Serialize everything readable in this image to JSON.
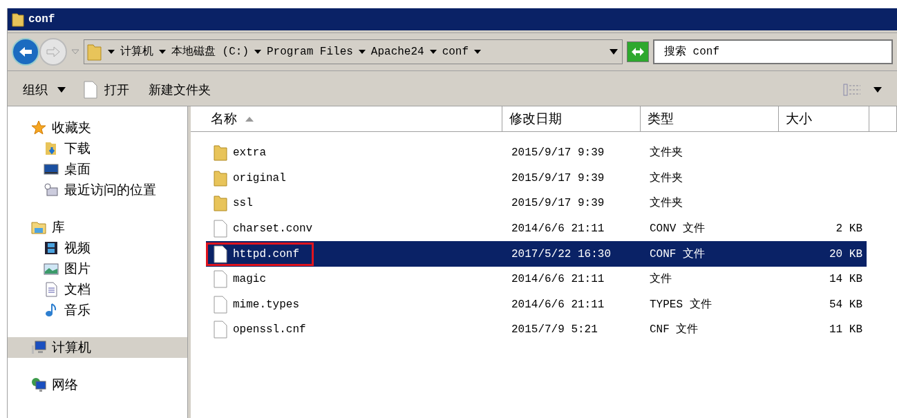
{
  "window": {
    "title": "conf"
  },
  "breadcrumbs": [
    "计算机",
    "本地磁盘 (C:)",
    "Program Files",
    "Apache24",
    "conf"
  ],
  "search": {
    "value": "搜索 conf"
  },
  "toolbar": {
    "organize": "组织",
    "open": "打开",
    "new_folder": "新建文件夹"
  },
  "sidebar": {
    "groups": [
      {
        "label": "收藏夹",
        "kind": "star",
        "selected": false,
        "children": [
          {
            "label": "下载",
            "kind": "download"
          },
          {
            "label": "桌面",
            "kind": "desktop"
          },
          {
            "label": "最近访问的位置",
            "kind": "recent"
          }
        ]
      },
      {
        "label": "库",
        "kind": "library",
        "selected": false,
        "children": [
          {
            "label": "视频",
            "kind": "video"
          },
          {
            "label": "图片",
            "kind": "image"
          },
          {
            "label": "文档",
            "kind": "doc"
          },
          {
            "label": "音乐",
            "kind": "music"
          }
        ]
      },
      {
        "label": "计算机",
        "kind": "computer",
        "selected": true
      },
      {
        "label": "网络",
        "kind": "network",
        "selected": false
      }
    ]
  },
  "table": {
    "columns": [
      {
        "label": "名称",
        "sorted": true
      },
      {
        "label": "修改日期",
        "sorted": false
      },
      {
        "label": "类型",
        "sorted": false
      },
      {
        "label": "大小",
        "sorted": false
      }
    ],
    "rows": [
      {
        "kind": "folder",
        "name": "extra",
        "date": "2015/9/17 9:39",
        "type": "文件夹",
        "selected": false,
        "highlighted": false
      },
      {
        "kind": "folder",
        "name": "original",
        "date": "2015/9/17 9:39",
        "type": "文件夹",
        "selected": false,
        "highlighted": false
      },
      {
        "kind": "folder",
        "name": "ssl",
        "date": "2015/9/17 9:39",
        "type": "文件夹",
        "selected": false,
        "highlighted": false
      },
      {
        "kind": "file",
        "name": "charset.conv",
        "date": "2014/6/6 21:11",
        "type": "CONV 文件",
        "size": "2 KB",
        "selected": false,
        "highlighted": false
      },
      {
        "kind": "file",
        "name": "httpd.conf",
        "date": "2017/5/22 16:30",
        "type": "CONF 文件",
        "size": "20 KB",
        "selected": true,
        "highlighted": true
      },
      {
        "kind": "file",
        "name": "magic",
        "date": "2014/6/6 21:11",
        "type": "文件",
        "size": "14 KB",
        "selected": false,
        "highlighted": false
      },
      {
        "kind": "file",
        "name": "mime.types",
        "date": "2014/6/6 21:11",
        "type": "TYPES 文件",
        "size": "54 KB",
        "selected": false,
        "highlighted": false
      },
      {
        "kind": "file",
        "name": "openssl.cnf",
        "date": "2015/7/9 5:21",
        "type": "CNF 文件",
        "size": "11 KB",
        "selected": false,
        "highlighted": false
      }
    ]
  }
}
